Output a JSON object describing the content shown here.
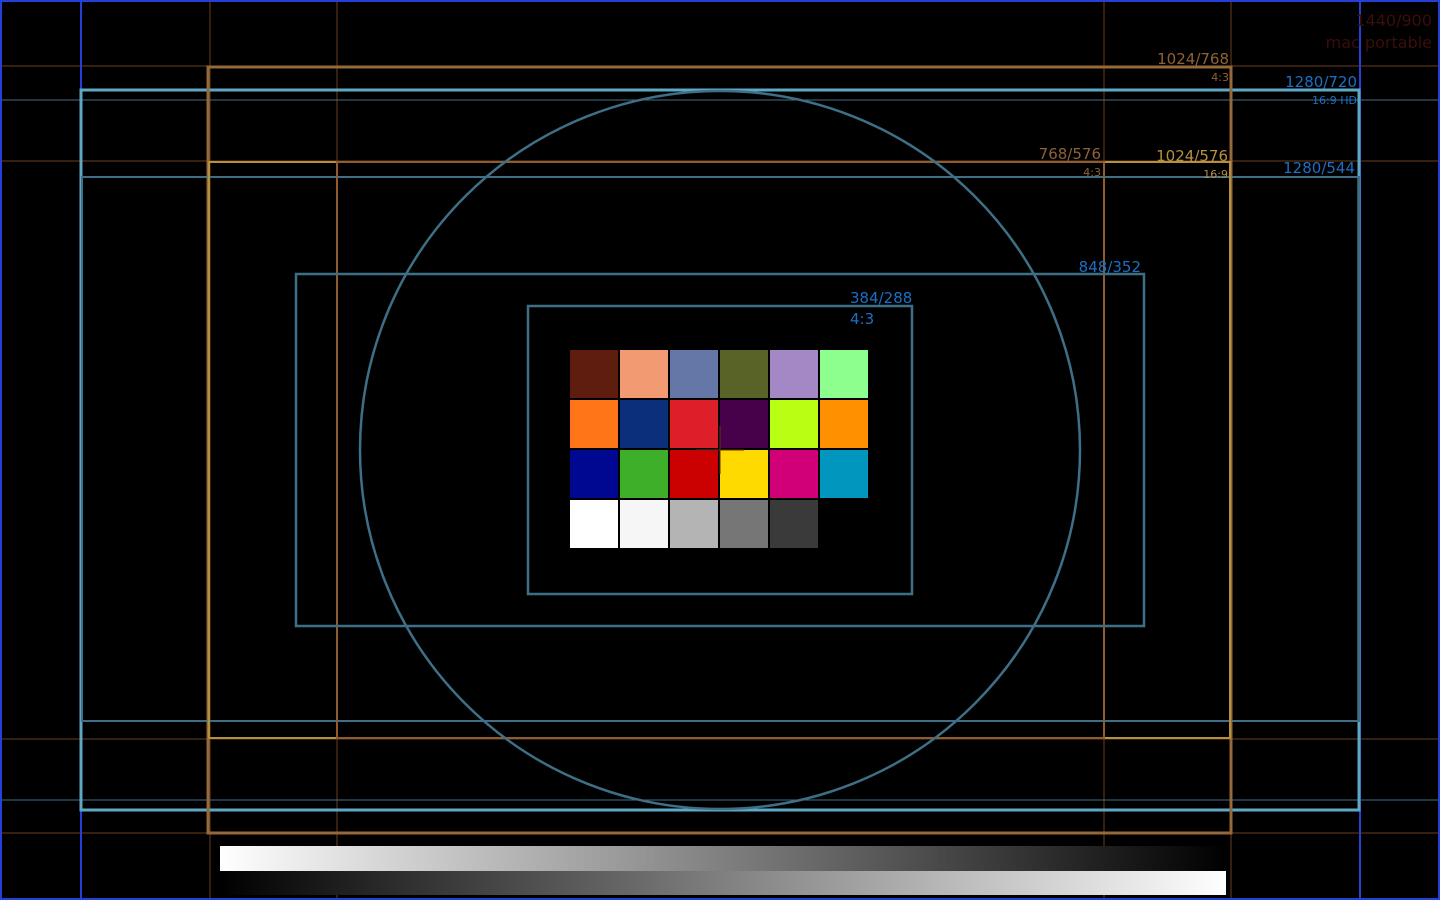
{
  "resolution_labels": {
    "mac_portable": {
      "value": "1440/900",
      "caption": "mac portable"
    },
    "xga": {
      "value": "1024/768",
      "caption": "4:3"
    },
    "hd720": {
      "value": "1280/720",
      "caption": "16:9 HD"
    },
    "pal_43": {
      "value": "768/576",
      "caption": "4:3"
    },
    "pal_169": {
      "value": "1024/576",
      "caption": "16:9"
    },
    "cinemascope": {
      "value": "1280/544"
    },
    "wide_sd": {
      "value": "848/352"
    },
    "cif": {
      "value": "384/288",
      "caption": "4:3"
    }
  },
  "color_patches": [
    [
      "#5E1D0F",
      "#F29B72",
      "#6477A7",
      "#596227",
      "#A388C5",
      "#8CFF8F"
    ],
    [
      "#FF7518",
      "#0B2F7A",
      "#DC1F29",
      "#47004A",
      "#BAFF13",
      "#FF9000"
    ],
    [
      "#000892",
      "#3EAF29",
      "#CB0000",
      "#FFDA00",
      "#D20078",
      "#0096BE"
    ],
    [
      "#FFFFFF",
      "#F6F6F6",
      "#B4B4B4",
      "#767676",
      "#3A3A3A",
      "#000000"
    ]
  ],
  "colors": {
    "background": "#000000",
    "frame_blue": "#5FA8C4",
    "frame_blue_dark": "#3E6F86",
    "frame_brown": "#96693A",
    "frame_gold": "#B7903F",
    "edge_blue": "#2341D6",
    "label_blue": "#1C6FC5",
    "label_brown": "#8F6236",
    "label_dark_red": "#3A0E0A"
  }
}
